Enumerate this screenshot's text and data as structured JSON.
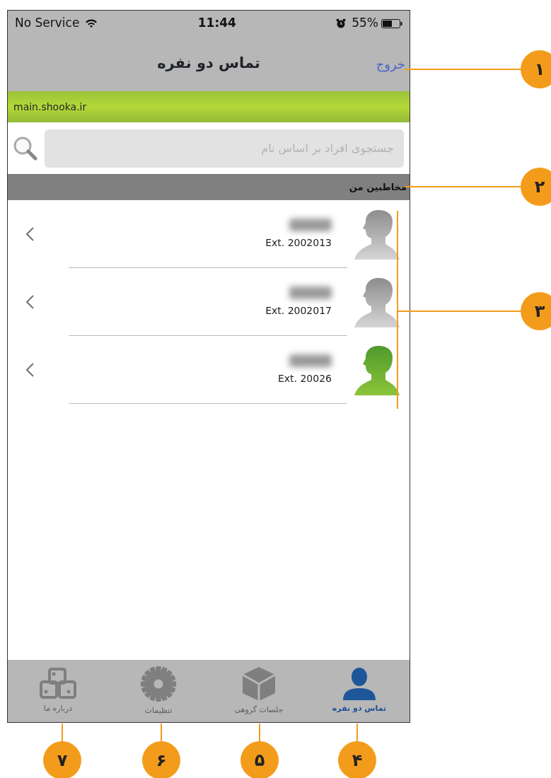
{
  "status_bar": {
    "carrier": "No Service",
    "time": "11:44",
    "battery": "55%"
  },
  "nav": {
    "title": "تماس دو نفره",
    "logout": "خروج"
  },
  "server": "main.shooka.ir",
  "search": {
    "placeholder": "جستجوی افراد بر اساس نام"
  },
  "section": "مخاطبین من",
  "contacts": [
    {
      "ext": "Ext. 2002013",
      "online": false
    },
    {
      "ext": "Ext. 2002017",
      "online": false
    },
    {
      "ext": "Ext. 20026",
      "online": true
    }
  ],
  "tabs": [
    {
      "label": "تماس دو نفره",
      "selected": true,
      "kind": "person"
    },
    {
      "label": "جلسات گروهی",
      "selected": false,
      "kind": "cube"
    },
    {
      "label": "تنظیمات",
      "selected": false,
      "kind": "gear"
    },
    {
      "label": "درباره ما",
      "selected": false,
      "kind": "blocks"
    }
  ],
  "callouts": [
    {
      "number": "۱",
      "kind": "side"
    },
    {
      "number": "۲",
      "kind": "side"
    },
    {
      "number": "۳",
      "kind": "bracket"
    },
    {
      "number": "۴",
      "kind": "below"
    },
    {
      "number": "۵",
      "kind": "below"
    },
    {
      "number": "۶",
      "kind": "below"
    },
    {
      "number": "۷",
      "kind": "below"
    }
  ]
}
